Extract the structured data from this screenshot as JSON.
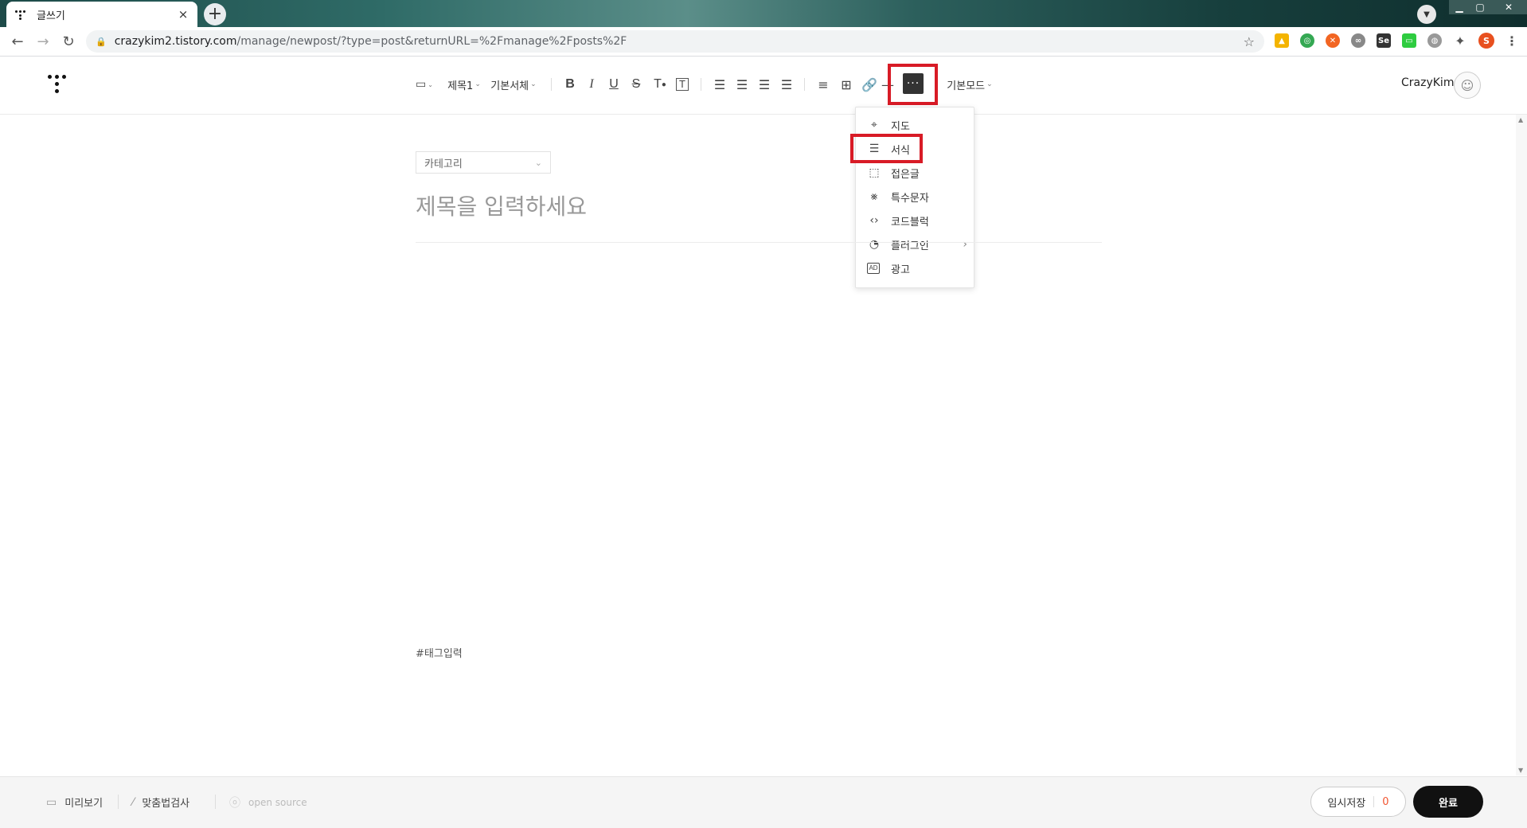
{
  "browser": {
    "tab_title": "글쓰기",
    "tab_close": "×",
    "new_tab": "+",
    "url_host": "crazykim2.tistory.com",
    "url_path": "/manage/newpost/?type=post&returnURL=%2Fmanage%2Fposts%2F",
    "profile_initial": "S"
  },
  "toolbar": {
    "image_label": "▭",
    "heading_label": "제목1",
    "font_label": "기본서체",
    "bold": "B",
    "italic": "I",
    "underline": "U",
    "strike": "S",
    "text_color": "T",
    "text_bg": "T",
    "more": "···",
    "mode_label": "기본모드"
  },
  "user": {
    "name": "CrazyKim"
  },
  "more_menu": {
    "items": [
      {
        "label": "지도",
        "icon": "map-pin-icon"
      },
      {
        "label": "서식",
        "icon": "template-icon"
      },
      {
        "label": "접은글",
        "icon": "fold-box-icon"
      },
      {
        "label": "특수문자",
        "icon": "special-char-icon"
      },
      {
        "label": "코드블럭",
        "icon": "code-icon"
      },
      {
        "label": "플러그인",
        "icon": "plugin-icon"
      },
      {
        "label": "광고",
        "icon": "ad-icon"
      }
    ]
  },
  "content": {
    "category_label": "카테고리",
    "title_placeholder": "제목을 입력하세요",
    "tag_placeholder": "#태그입력"
  },
  "footer": {
    "preview": "미리보기",
    "spellcheck": "맞춤법검사",
    "opensource": "open source",
    "temp_save": "임시저장",
    "temp_count": "0",
    "done": "완료"
  }
}
